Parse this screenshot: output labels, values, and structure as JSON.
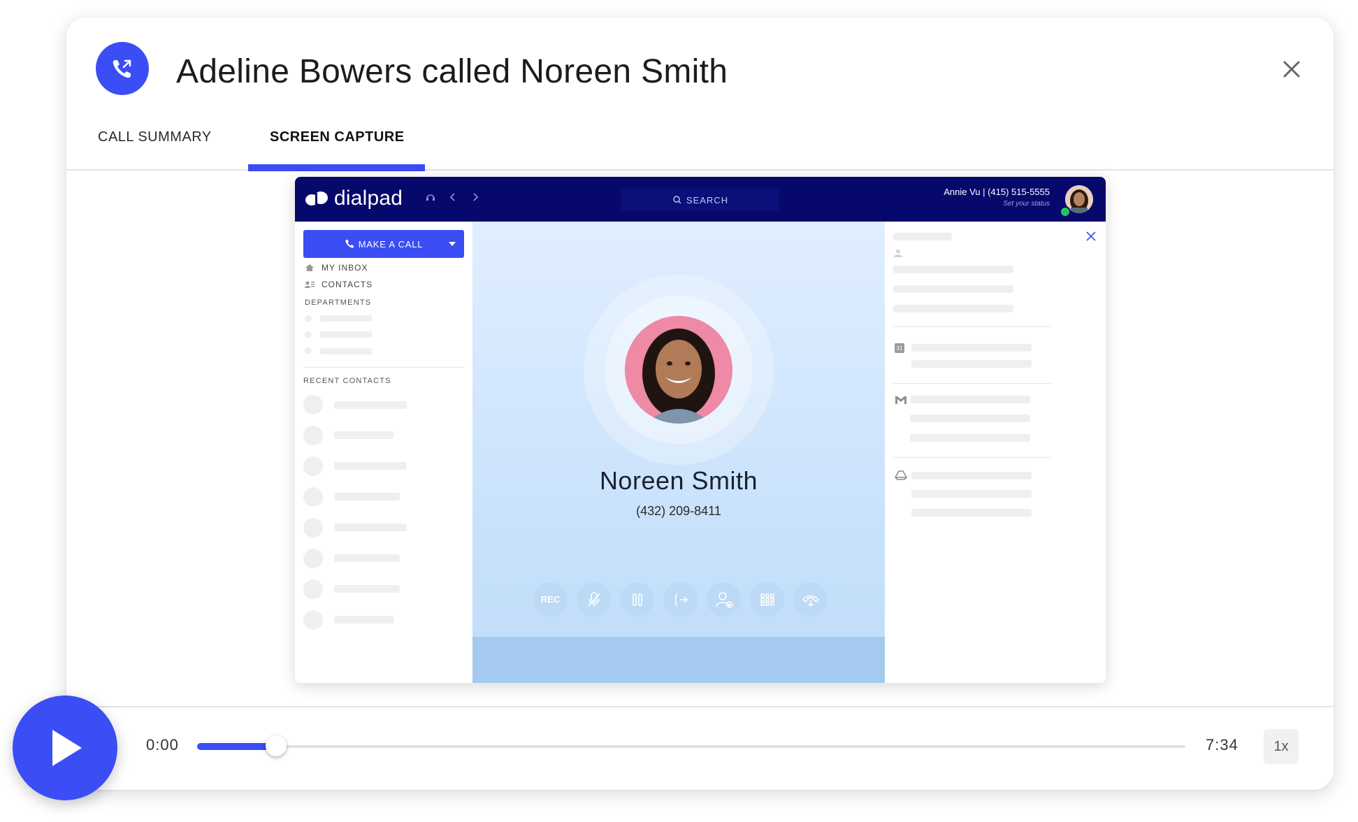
{
  "header": {
    "title": "Adeline Bowers called Noreen Smith"
  },
  "tabs": [
    {
      "label": "CALL SUMMARY",
      "active": false
    },
    {
      "label": "SCREEN CAPTURE",
      "active": true
    }
  ],
  "app": {
    "logo_text": "dialpad",
    "search_label": "SEARCH",
    "user": {
      "name": "Annie Vu | (415) 515-5555",
      "status": "Set your status"
    },
    "sidebar": {
      "make_call_label": "MAKE A CALL",
      "items": [
        "MY INBOX",
        "CONTACTS"
      ],
      "departments_heading": "DEPARTMENTS",
      "recent_heading": "RECENT CONTACTS"
    },
    "call": {
      "contact_name": "Noreen Smith",
      "contact_phone": "(432) 209-8411",
      "controls": [
        {
          "name": "record",
          "label": "REC"
        },
        {
          "name": "mute",
          "icon": "mic-off-icon"
        },
        {
          "name": "hold",
          "icon": "pause-icon"
        },
        {
          "name": "transfer",
          "icon": "transfer-icon"
        },
        {
          "name": "add-person",
          "icon": "add-person-icon"
        },
        {
          "name": "keypad",
          "icon": "keypad-icon"
        },
        {
          "name": "hangup",
          "icon": "hangup-icon"
        }
      ]
    },
    "side_panel": {
      "calendar_day": "31"
    }
  },
  "player": {
    "current_time": "0:00",
    "total_time": "7:34",
    "progress_fraction": 0.08,
    "speed": "1x"
  },
  "colors": {
    "accent": "#3b4df4",
    "topbar": "#06096b"
  }
}
